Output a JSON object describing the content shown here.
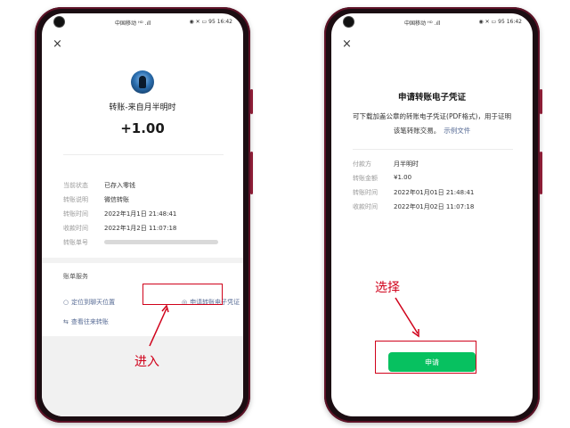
{
  "status_bar": {
    "carrier": "中国移动",
    "signal": "ᴴᴰ .ıll",
    "icons": "◉ ✕ ▭",
    "battery_pct": "95",
    "time": "16:42"
  },
  "left_screen": {
    "close_icon": "×",
    "payee": "转账-来自月半明时",
    "amount": "+1.00",
    "details": [
      {
        "label": "当前状态",
        "value": "已存入零钱"
      },
      {
        "label": "转账说明",
        "value": "微信转账"
      },
      {
        "label": "转账时间",
        "value": "2022年1月1日 21:48:41"
      },
      {
        "label": "收款时间",
        "value": "2022年1月2日 11:07:18"
      },
      {
        "label": "转账单号",
        "value": ""
      }
    ],
    "services_title": "账单服务",
    "services": {
      "locate": "定位到聊天位置",
      "voucher": "申请转账电子凭证",
      "history": "查看往来转账"
    }
  },
  "right_screen": {
    "close_icon": "×",
    "title": "申请转账电子凭证",
    "description": "可下载加盖公章的转账电子凭证(PDF格式)，用于证明该笔转账交易。",
    "example_link": "示例文件",
    "details": [
      {
        "label": "付款方",
        "value": "月半明时"
      },
      {
        "label": "转账金额",
        "value": "¥1.00"
      },
      {
        "label": "转账时间",
        "value": "2022年01月01日 21:48:41"
      },
      {
        "label": "收款时间",
        "value": "2022年01月02日 11:07:18"
      }
    ],
    "apply_button": "申请"
  },
  "annotations": {
    "enter": "进入",
    "select": "选择",
    "color": "#d0021b"
  },
  "colors": {
    "wechat_green": "#07c160",
    "link_blue": "#576b95",
    "phone_frame": "#5e1227"
  },
  "icons": {
    "close": "close-icon",
    "locate": "circle-icon",
    "voucher": "target-icon",
    "history": "transfer-icon"
  }
}
